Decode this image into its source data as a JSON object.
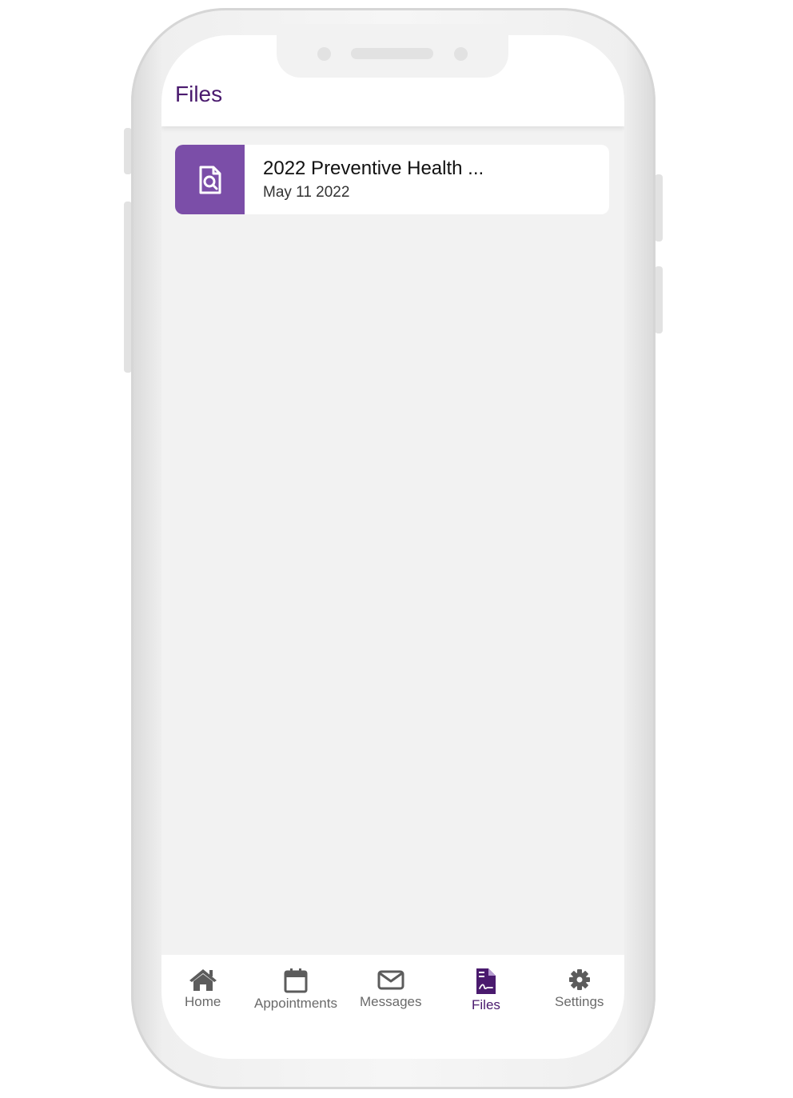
{
  "header": {
    "title": "Files"
  },
  "files": [
    {
      "title": "2022 Preventive Health ...",
      "date": "May 11 2022",
      "icon": "file-search-icon"
    }
  ],
  "nav": {
    "items": [
      {
        "label": "Home",
        "icon": "home-icon"
      },
      {
        "label": "Appointments",
        "icon": "calendar-icon"
      },
      {
        "label": "Messages",
        "icon": "envelope-icon"
      },
      {
        "label": "Files",
        "icon": "file-signature-icon",
        "active": true
      },
      {
        "label": "Settings",
        "icon": "gear-icon"
      }
    ]
  },
  "colors": {
    "brand_purple": "#4a1a6e",
    "thumb_purple": "#7b4ea8",
    "screen_bg": "#f2f2f2"
  }
}
